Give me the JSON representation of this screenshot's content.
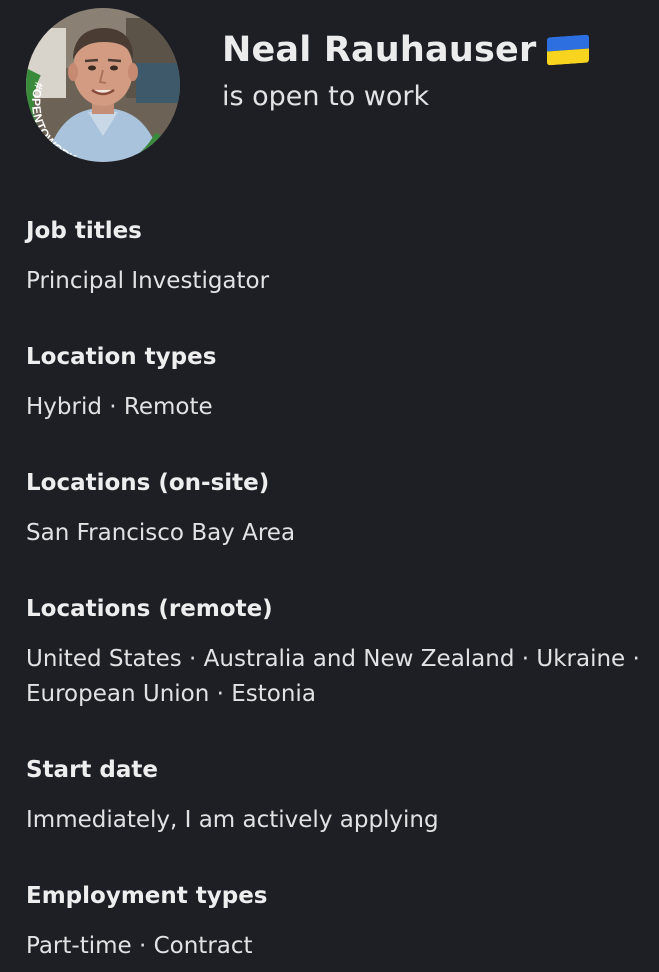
{
  "profile": {
    "name": "Neal Rauhauser",
    "flag_emoji_icon": "ukraine-flag-icon",
    "flag_colors": [
      "#2d6fe0",
      "#f8d41f"
    ],
    "subtitle": "is open to work",
    "badge_text": "#OPENTOWORK",
    "badge_color": "#3a8a3c"
  },
  "sections": [
    {
      "label": "Job titles",
      "value": "Principal Investigator"
    },
    {
      "label": "Location types",
      "value": "Hybrid · Remote"
    },
    {
      "label": "Locations (on-site)",
      "value": "San Francisco Bay Area"
    },
    {
      "label": "Locations (remote)",
      "value": "United States · Australia and New Zealand · Ukraine · European Union · Estonia"
    },
    {
      "label": "Start date",
      "value": "Immediately, I am actively applying"
    },
    {
      "label": "Employment types",
      "value": "Part-time · Contract"
    }
  ],
  "colors": {
    "background": "#1d1f25",
    "text": "#e9e9ea"
  }
}
